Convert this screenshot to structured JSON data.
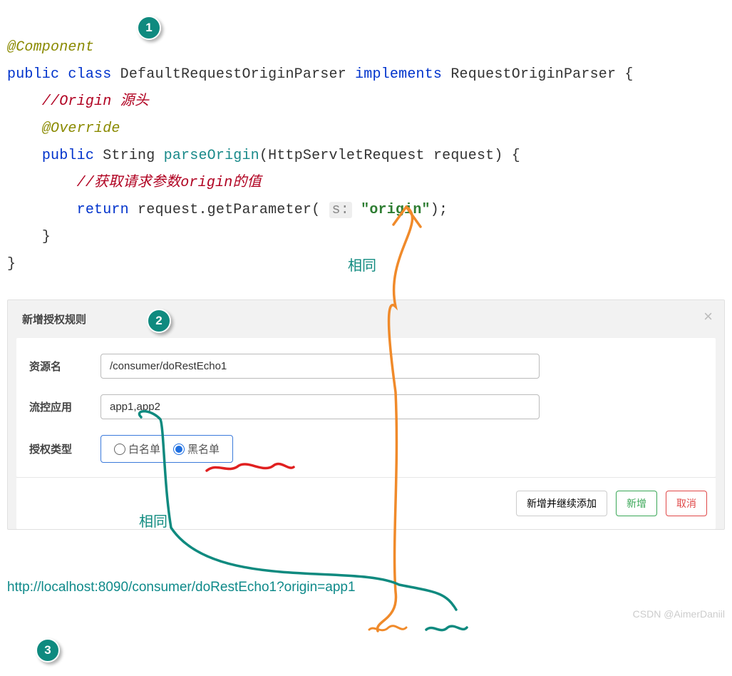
{
  "badges": {
    "b1": "1",
    "b2": "2",
    "b3": "3"
  },
  "code": {
    "annotation": "@Component",
    "kw_public": "public",
    "kw_class": "class",
    "class_name": "DefaultRequestOriginParser",
    "kw_implements": "implements",
    "iface": "RequestOriginParser",
    "brace_open": " {",
    "cmt1": "//Origin 源头",
    "override": "@Override",
    "ret_type": "String",
    "method": "parseOrigin",
    "arg_type": "HttpServletRequest",
    "arg_name": "request",
    "paren_close": ") {",
    "cmt2": "//获取请求参数origin的值",
    "kw_return": "return",
    "call_target": "request",
    "call_method": "getParameter",
    "hint": "s:",
    "str": "\"origin\"",
    "tail": ");",
    "brace_close1": "}",
    "brace_close2": "}"
  },
  "annotations": {
    "same1": "相同",
    "same2": "相同"
  },
  "dialog": {
    "title": "新增授权规则",
    "close": "×",
    "labels": {
      "resource": "资源名",
      "app": "流控应用",
      "type": "授权类型"
    },
    "resource_value": "/consumer/doRestEcho1",
    "app_value": "app1,app2",
    "radio_white": "白名单",
    "radio_black": "黑名单",
    "btn_add_continue": "新增并继续添加",
    "btn_add": "新增",
    "btn_cancel": "取消"
  },
  "url": "http://localhost:8090/consumer/doRestEcho1?origin=app1",
  "watermark": "CSDN @AimerDaniil"
}
